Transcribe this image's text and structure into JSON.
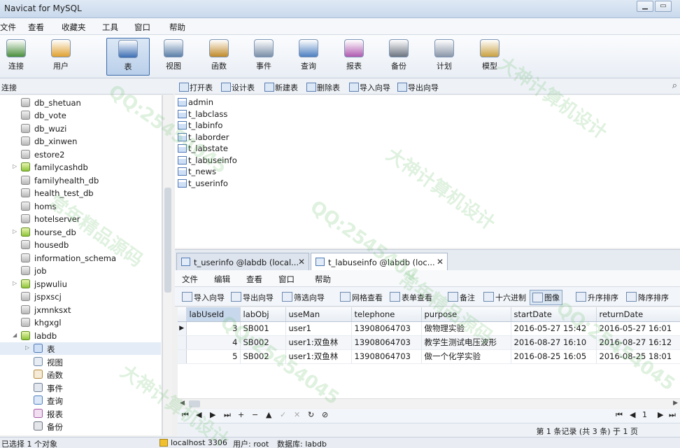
{
  "window": {
    "title": "Navicat for MySQL",
    "min_label": "▁",
    "restore_label": "▭"
  },
  "menu": [
    "文件",
    "查看",
    "收藏夹",
    "工具",
    "窗口",
    "帮助"
  ],
  "toolbar": [
    {
      "label": "连接",
      "icon": "connection-icon",
      "color": "#4a8f3c"
    },
    {
      "label": "用户",
      "icon": "user-icon",
      "color": "#e0a030"
    },
    {
      "label": "表",
      "icon": "table-icon",
      "color": "#3d6fb4"
    },
    {
      "label": "视图",
      "icon": "view-icon",
      "color": "#5b7fa8"
    },
    {
      "label": "函数",
      "icon": "function-icon",
      "color": "#c08a2a"
    },
    {
      "label": "事件",
      "icon": "event-icon",
      "color": "#7a8fa8"
    },
    {
      "label": "查询",
      "icon": "query-icon",
      "color": "#4c7fc0"
    },
    {
      "label": "报表",
      "icon": "report-icon",
      "color": "#b05ab0"
    },
    {
      "label": "备份",
      "icon": "backup-icon",
      "color": "#6c7480"
    },
    {
      "label": "计划",
      "icon": "schedule-icon",
      "color": "#8a96a8"
    },
    {
      "label": "模型",
      "icon": "model-icon",
      "color": "#c9a040"
    }
  ],
  "left_panel": {
    "header": "连接"
  },
  "tree": [
    {
      "label": "db_shetuan",
      "expandable": false,
      "active": false
    },
    {
      "label": "db_vote",
      "expandable": false,
      "active": false
    },
    {
      "label": "db_wuzi",
      "expandable": false,
      "active": false
    },
    {
      "label": "db_xinwen",
      "expandable": false,
      "active": false
    },
    {
      "label": "estore2",
      "expandable": false,
      "active": false
    },
    {
      "label": "familycashdb",
      "expandable": true,
      "active": true
    },
    {
      "label": "familyhealth_db",
      "expandable": false,
      "active": false
    },
    {
      "label": "health_test_db",
      "expandable": false,
      "active": false
    },
    {
      "label": "homs",
      "expandable": false,
      "active": false
    },
    {
      "label": "hotelserver",
      "expandable": false,
      "active": false
    },
    {
      "label": "hourse_db",
      "expandable": true,
      "active": true
    },
    {
      "label": "housedb",
      "expandable": false,
      "active": false
    },
    {
      "label": "information_schema",
      "expandable": false,
      "active": false
    },
    {
      "label": "job",
      "expandable": false,
      "active": false
    },
    {
      "label": "jspwuliu",
      "expandable": true,
      "active": true
    },
    {
      "label": "jspxscj",
      "expandable": false,
      "active": false
    },
    {
      "label": "jxmnksxt",
      "expandable": false,
      "active": false
    },
    {
      "label": "khgxgl",
      "expandable": false,
      "active": false
    },
    {
      "label": "labdb",
      "expandable": true,
      "active": true,
      "expanded": true
    }
  ],
  "tree_children": [
    "表",
    "视图",
    "函数",
    "事件",
    "查询",
    "报表",
    "备份"
  ],
  "object_toolbar": [
    "打开表",
    "设计表",
    "新建表",
    "删除表",
    "导入向导",
    "导出向导"
  ],
  "tables": [
    "admin",
    "t_labclass",
    "t_labinfo",
    "t_laborder",
    "t_labstate",
    "t_labuseinfo",
    "t_news",
    "t_userinfo"
  ],
  "tabs": [
    {
      "label": "t_userinfo @labdb (local...",
      "active": false
    },
    {
      "label": "t_labuseinfo @labdb (loc...",
      "active": true
    }
  ],
  "inner_menu": [
    "文件",
    "编辑",
    "查看",
    "窗口",
    "帮助"
  ],
  "inner_toolbar": [
    "导入向导",
    "导出向导",
    "筛选向导",
    "网格查看",
    "表单查看",
    "备注",
    "十六进制",
    "图像",
    "升序排序",
    "降序排序"
  ],
  "grid": {
    "columns": [
      "labUseId",
      "labObj",
      "useMan",
      "telephone",
      "purpose",
      "startDate",
      "returnDate"
    ],
    "rows": [
      [
        "3",
        "SB001",
        "user1",
        "13908064703",
        "做物理实验",
        "2016-05-27 15:42",
        "2016-05-27 16:01"
      ],
      [
        "4",
        "SB002",
        "user1:双鱼林",
        "13908064703",
        "教学生测试电压波形",
        "2016-08-27 16:10",
        "2016-08-27 16:12"
      ],
      [
        "5",
        "SB002",
        "user1:双鱼林",
        "13908064703",
        "做一个化学实验",
        "2016-08-25 16:05",
        "2016-08-25 18:01"
      ]
    ],
    "current_row_marker": "▶"
  },
  "nav": {
    "buttons": [
      "⏮",
      "◀",
      "▶",
      "⏭",
      "+",
      "−",
      "▲",
      "✓",
      "✕",
      "↻",
      "⊘"
    ],
    "page_controls": [
      "⏮",
      "◀",
      "1",
      "▶",
      "⏭"
    ]
  },
  "record_status": "第 1 条记录 (共 3 条) 于 1 页",
  "statusbar": {
    "selected": "已选择 1 个对象",
    "host": "localhost 3306",
    "user": "用户: root",
    "database": "数据库: labdb"
  },
  "watermarks": [
    "QQ:25454045",
    "大神计算机设计",
    "QQ:2545404",
    "常年精品源码",
    "大神计算机设计",
    "QQ:25454045",
    "常年精品源码",
    "QQ:25454045",
    "大神计算机设计"
  ]
}
